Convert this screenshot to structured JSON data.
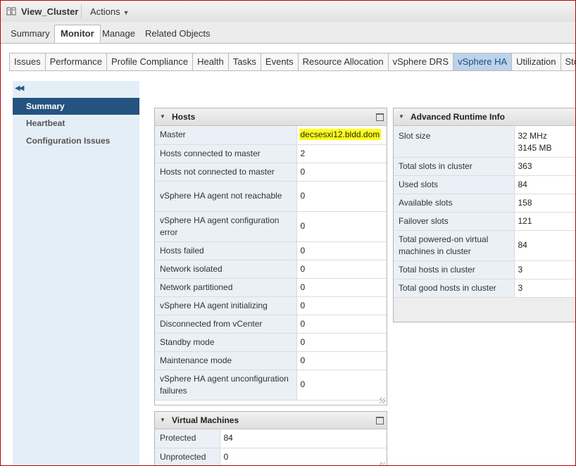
{
  "titlebar": {
    "title": "View_Cluster",
    "actions_label": "Actions"
  },
  "top_tabs": [
    "Summary",
    "Monitor",
    "Manage",
    "Related Objects"
  ],
  "sub_tabs": [
    "Issues",
    "Performance",
    "Profile Compliance",
    "Health",
    "Tasks",
    "Events",
    "Resource Allocation",
    "vSphere DRS",
    "vSphere HA",
    "Utilization",
    "Storage R"
  ],
  "left_nav": [
    "Summary",
    "Heartbeat",
    "Configuration Issues"
  ],
  "hosts": {
    "title": "Hosts",
    "rows": [
      {
        "label": "Master",
        "value": "decsesxi12.bldd.dom"
      },
      {
        "label": "Hosts connected to master",
        "value": "2"
      },
      {
        "label": "Hosts not connected to master",
        "value": "0"
      },
      {
        "label": "vSphere HA agent not reachable",
        "value": "0"
      },
      {
        "label": "vSphere HA agent configuration error",
        "value": "0"
      },
      {
        "label": "Hosts failed",
        "value": "0"
      },
      {
        "label": "Network isolated",
        "value": "0"
      },
      {
        "label": "Network partitioned",
        "value": "0"
      },
      {
        "label": "vSphere HA agent initializing",
        "value": "0"
      },
      {
        "label": "Disconnected from vCenter",
        "value": "0"
      },
      {
        "label": "Standby mode",
        "value": "0"
      },
      {
        "label": "Maintenance mode",
        "value": "0"
      },
      {
        "label": "vSphere HA agent unconfiguration failures",
        "value": "0"
      }
    ]
  },
  "virtual_machines": {
    "title": "Virtual Machines",
    "rows": [
      {
        "label": "Protected",
        "value": "84"
      },
      {
        "label": "Unprotected",
        "value": "0"
      }
    ]
  },
  "runtime": {
    "title": "Advanced Runtime Info",
    "slot_size_mhz": "32 MHz",
    "slot_size_mb": "3145 MB",
    "rows": [
      {
        "label": "Slot size",
        "value": "32 MHz"
      },
      {
        "label": "Total slots in cluster",
        "value": "363"
      },
      {
        "label": "Used slots",
        "value": "84"
      },
      {
        "label": "Available slots",
        "value": "158"
      },
      {
        "label": "Failover slots",
        "value": "121"
      },
      {
        "label": "Total powered-on virtual machines in cluster",
        "value": "84"
      },
      {
        "label": "Total hosts in cluster",
        "value": "3"
      },
      {
        "label": "Total good hosts in cluster",
        "value": "3"
      }
    ]
  },
  "colors": {
    "highlight": "#ffff1a",
    "nav_active": "#25537f",
    "tab_active": "#bcd3ea",
    "frame": "#c00000"
  }
}
